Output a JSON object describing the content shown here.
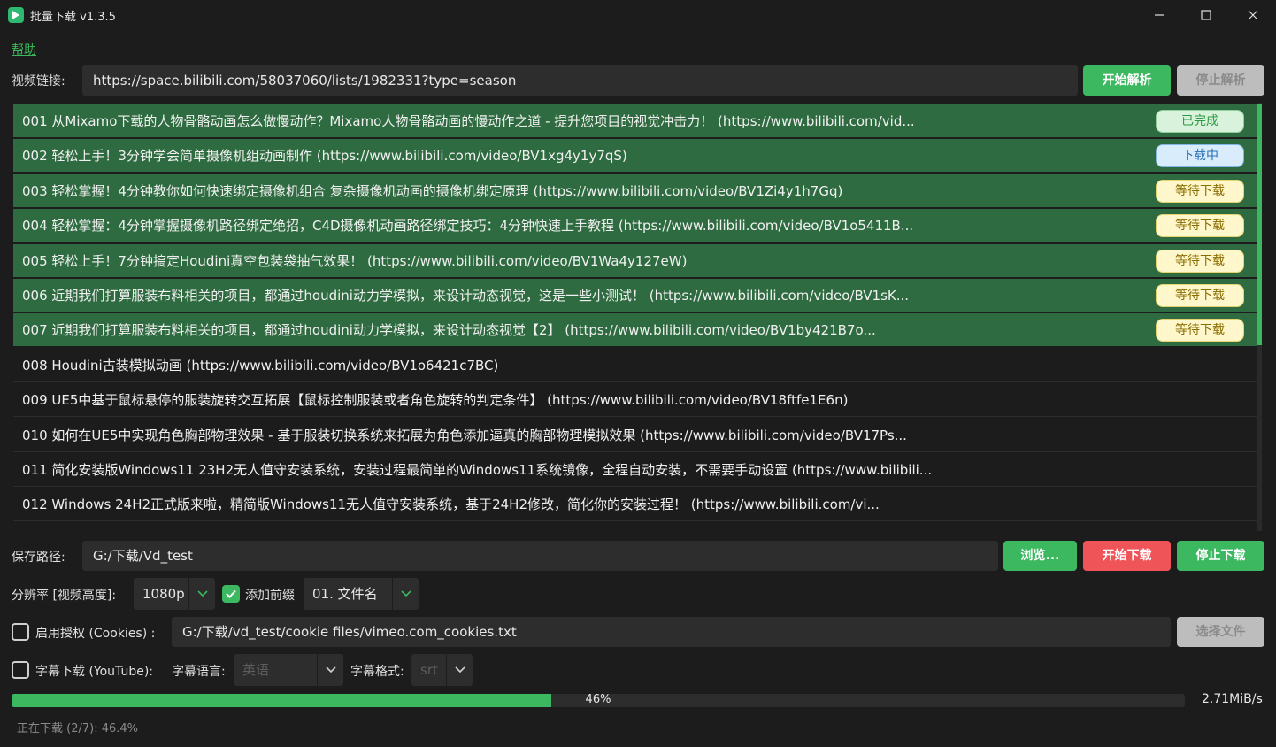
{
  "window": {
    "title": "批量下载 v1.3.5",
    "accent": "#3cb860"
  },
  "menu": {
    "help": "帮助"
  },
  "url_bar": {
    "label": "视频链接:",
    "value": "https://space.bilibili.com/58037060/lists/1982331?type=season",
    "start_parse": "开始解析",
    "stop_parse": "停止解析"
  },
  "videos": [
    {
      "text": "001 从Mixamo下载的人物骨骼动画怎么做慢动作？Mixamo人物骨骼动画的慢动作之道 - 提升您项目的视觉冲击力！ (https://www.bilibili.com/vid...",
      "status": "已完成",
      "state": "done"
    },
    {
      "text": "002 轻松上手！3分钟学会简单摄像机组动画制作 (https://www.bilibili.com/video/BV1xg4y1y7qS)",
      "status": "下载中",
      "state": "downloading"
    },
    {
      "text": "003 轻松掌握！4分钟教你如何快速绑定摄像机组合 复杂摄像机动画的摄像机绑定原理 (https://www.bilibili.com/video/BV1Zi4y1h7Gq)",
      "status": "等待下载",
      "state": "waiting"
    },
    {
      "text": "004 轻松掌握：4分钟掌握摄像机路径绑定绝招，C4D摄像机动画路径绑定技巧：4分钟快速上手教程 (https://www.bilibili.com/video/BV1o5411B...",
      "status": "等待下载",
      "state": "waiting"
    },
    {
      "text": "005 轻松上手！7分钟搞定Houdini真空包装袋抽气效果！ (https://www.bilibili.com/video/BV1Wa4y127eW)",
      "status": "等待下载",
      "state": "waiting"
    },
    {
      "text": "006 近期我们打算服装布料相关的项目，都通过houdini动力学模拟，来设计动态视觉，这是一些小测试！ (https://www.bilibili.com/video/BV1sK...",
      "status": "等待下载",
      "state": "waiting"
    },
    {
      "text": "007 近期我们打算服装布料相关的项目，都通过houdini动力学模拟，来设计动态视觉【2】 (https://www.bilibili.com/video/BV1by421B7o...",
      "status": "等待下载",
      "state": "waiting"
    },
    {
      "text": "008 Houdini古装模拟动画 (https://www.bilibili.com/video/BV1o6421c7BC)",
      "status": "",
      "state": "none"
    },
    {
      "text": "009 UE5中基于鼠标悬停的服装旋转交互拓展【鼠标控制服装或者角色旋转的判定条件】 (https://www.bilibili.com/video/BV18ftfe1E6n)",
      "status": "",
      "state": "none"
    },
    {
      "text": "010 如何在UE5中实现角色胸部物理效果 - 基于服装切换系统来拓展为角色添加逼真的胸部物理模拟效果 (https://www.bilibili.com/video/BV17Ps...",
      "status": "",
      "state": "none"
    },
    {
      "text": "011 简化安装版Windows11 23H2无人值守安装系统，安装过程最简单的Windows11系统镜像，全程自动安装，不需要手动设置 (https://www.bilibili...",
      "status": "",
      "state": "none"
    },
    {
      "text": "012 Windows 24H2正式版来啦，精简版Windows11无人值守安装系统，基于24H2修改，简化你的安装过程！ (https://www.bilibili.com/vi...",
      "status": "",
      "state": "none"
    }
  ],
  "save": {
    "label": "保存路径:",
    "value": "G:/下载/Vd_test",
    "browse": "浏览...",
    "start_download": "开始下载",
    "stop_download": "停止下载"
  },
  "options": {
    "resolution_label": "分辨率 [视频高度]:",
    "resolution_value": "1080p",
    "prefix_label": "添加前缀",
    "prefix_checked": true,
    "prefix_value": "01. 文件名"
  },
  "cookies": {
    "label": "启用授权 (Cookies) :",
    "checked": false,
    "value": "G:/下载/vd_test/cookie files/vimeo.com_cookies.txt",
    "choose_file": "选择文件"
  },
  "subtitles": {
    "label": "字幕下载 (YouTube):",
    "checked": false,
    "lang_label": "字幕语言:",
    "lang_value": "英语",
    "format_label": "字幕格式:",
    "format_value": "srt"
  },
  "progress": {
    "percent": 46,
    "percent_text": "46%",
    "speed": "2.71MiB/s"
  },
  "status_text": "正在下载 (2/7): 46.4%"
}
